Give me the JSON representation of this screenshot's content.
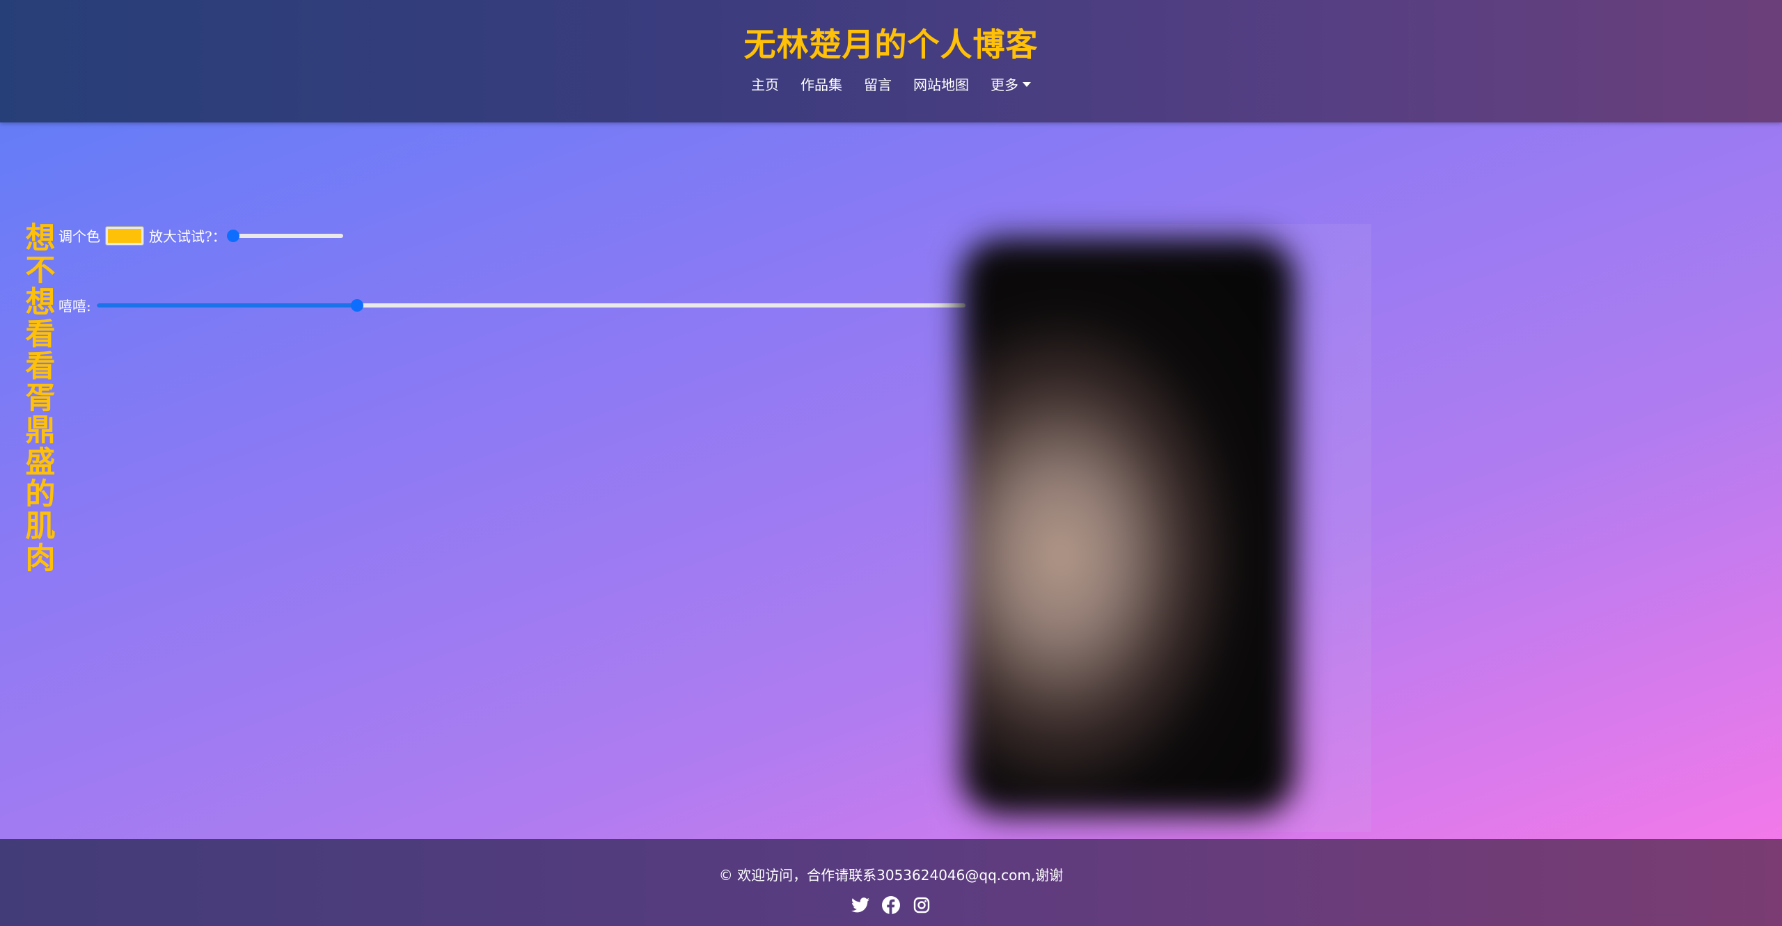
{
  "header": {
    "title": "无林楚月的个人博客",
    "nav": [
      {
        "label": "主页"
      },
      {
        "label": "作品集"
      },
      {
        "label": "留言"
      },
      {
        "label": "网站地图"
      },
      {
        "label": "更多"
      }
    ]
  },
  "main": {
    "vertical_title": "想不想看看胥鼎盛的肌肉",
    "color_label": "调个色",
    "color_value": "#ffc107",
    "zoom_label": "放大试试?：",
    "zoom_level": 0.0,
    "xixi_label": "嘻嘻:",
    "xixi_level": 0.3
  },
  "footer": {
    "text": "© 欢迎访问，合作请联系3053624046@qq.com,谢谢",
    "social": [
      "twitter-icon",
      "facebook-icon",
      "instagram-icon"
    ]
  },
  "colors": {
    "accent": "#ffc107",
    "slider": "#0d6efd"
  }
}
